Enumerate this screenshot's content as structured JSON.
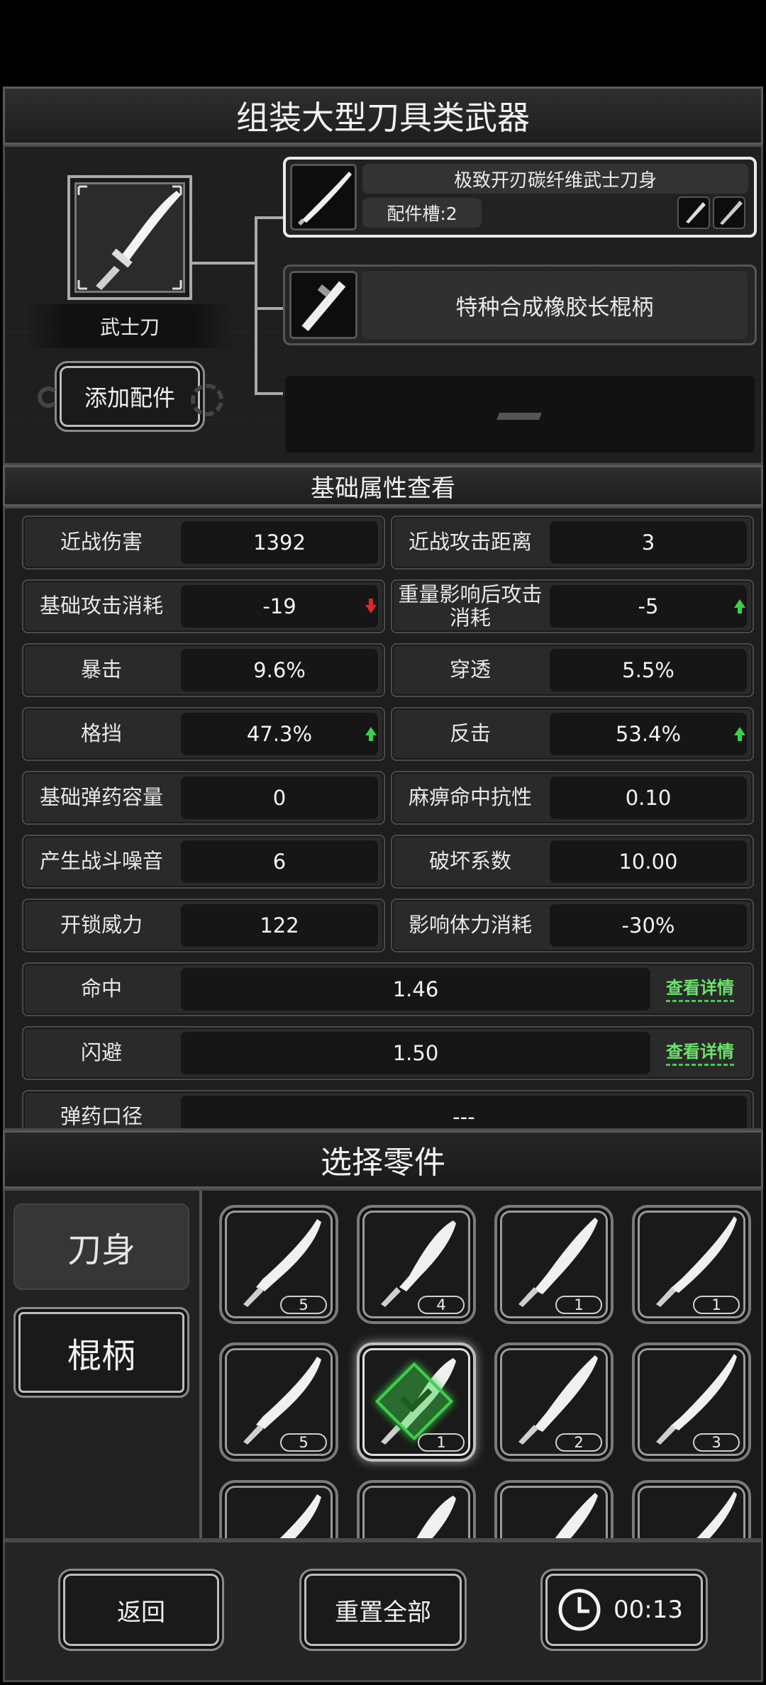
{
  "header": {
    "title": "组装大型刀具类武器"
  },
  "weapon": {
    "name": "武士刀",
    "add_parts_label": "添加配件"
  },
  "slots": [
    {
      "name": "极致开刃碳纤维武士刀身",
      "sub_label": "配件槽:2"
    },
    {
      "name": "特种合成橡胶长棍柄"
    },
    {
      "name": ""
    }
  ],
  "stats_section": {
    "title": "基础属性查看"
  },
  "stats": [
    {
      "label": "近战伤害",
      "value": "1392"
    },
    {
      "label": "近战攻击距离",
      "value": "3"
    },
    {
      "label": "基础攻击消耗",
      "value": "-19",
      "trend": "down"
    },
    {
      "label": "重量影响后攻击消耗",
      "value": "-5",
      "trend": "up"
    },
    {
      "label": "暴击",
      "value": "9.6%"
    },
    {
      "label": "穿透",
      "value": "5.5%"
    },
    {
      "label": "格挡",
      "value": "47.3%",
      "trend": "up"
    },
    {
      "label": "反击",
      "value": "53.4%",
      "trend": "up"
    },
    {
      "label": "基础弹药容量",
      "value": "0"
    },
    {
      "label": "麻痹命中抗性",
      "value": "0.10"
    },
    {
      "label": "产生战斗噪音",
      "value": "6"
    },
    {
      "label": "破坏系数",
      "value": "10.00"
    },
    {
      "label": "开锁威力",
      "value": "122"
    },
    {
      "label": "影响体力消耗",
      "value": "-30%"
    }
  ],
  "wide_stats": [
    {
      "label": "命中",
      "value": "1.46",
      "link": "查看详情"
    },
    {
      "label": "闪避",
      "value": "1.50",
      "link": "查看详情"
    },
    {
      "label": "弹药口径",
      "value": "---"
    }
  ],
  "parts_section": {
    "title": "选择零件",
    "tabs": [
      {
        "label": "刀身"
      },
      {
        "label": "棍柄"
      }
    ],
    "parts": [
      {
        "count": "5"
      },
      {
        "count": "4"
      },
      {
        "count": "1"
      },
      {
        "count": "1"
      },
      {
        "count": "5"
      },
      {
        "count": "1",
        "selected": true
      },
      {
        "count": "2"
      },
      {
        "count": "3"
      },
      {
        "count": ""
      },
      {
        "count": ""
      },
      {
        "count": ""
      },
      {
        "count": ""
      }
    ]
  },
  "footer": {
    "back_label": "返回",
    "reset_label": "重置全部",
    "timer": "00:13"
  },
  "colors": {
    "up": "#3ecf4a",
    "down": "#e02626",
    "selected": "#3ecf4a"
  }
}
